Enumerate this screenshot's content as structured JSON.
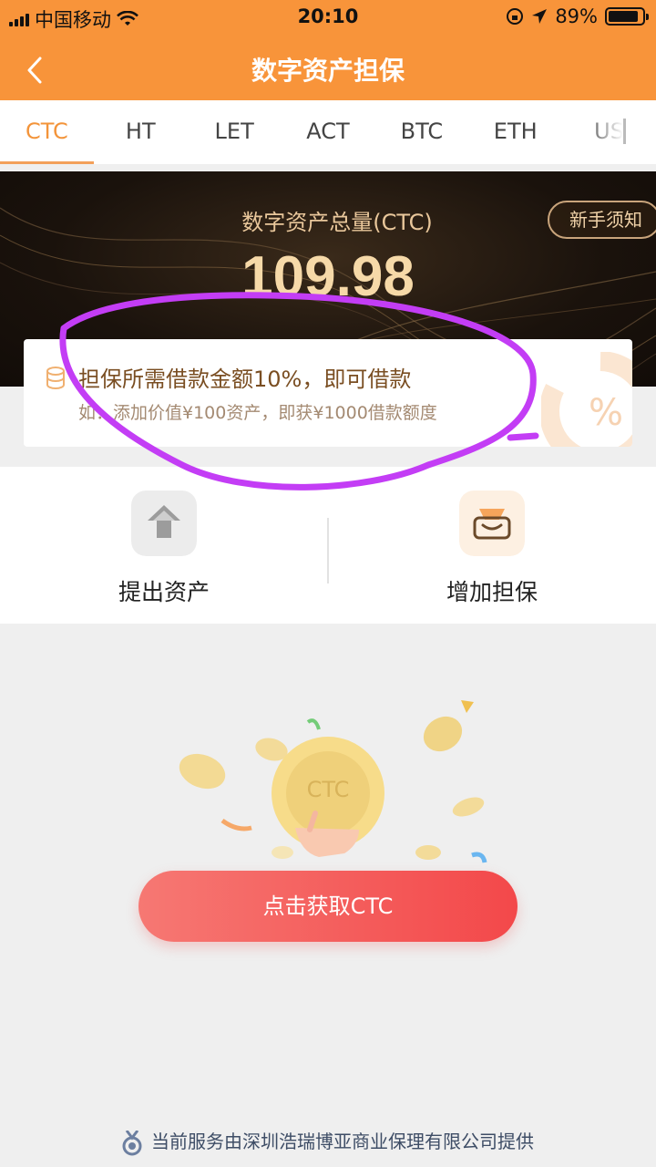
{
  "status_bar": {
    "carrier": "中国移动",
    "time": "20:10",
    "battery": "89%",
    "battery_level": 0.89
  },
  "nav": {
    "title": "数字资产担保"
  },
  "tabs": [
    {
      "label": "CTC",
      "active": true
    },
    {
      "label": "HT",
      "active": false
    },
    {
      "label": "LET",
      "active": false
    },
    {
      "label": "ACT",
      "active": false
    },
    {
      "label": "BTC",
      "active": false
    },
    {
      "label": "ETH",
      "active": false
    },
    {
      "label": "US",
      "active": false
    }
  ],
  "banner": {
    "label": "数字资产总量(CTC)",
    "value": "109.98",
    "newbie_button": "新手须知"
  },
  "info": {
    "line1": "担保所需借款金额10%，即可借款",
    "line2": "如：添加价值¥100资产，即获¥1000借款额度"
  },
  "actions": [
    {
      "label": "提出资产",
      "icon": "upload-arrow-icon"
    },
    {
      "label": "增加担保",
      "icon": "wallet-icon"
    }
  ],
  "illustration": {
    "coin_label": "CTC"
  },
  "cta": {
    "label": "点击获取CTC"
  },
  "footer": {
    "text": "当前服务由深圳浩瑞博亚商业保理有限公司提供"
  },
  "colors": {
    "accent": "#f8943a",
    "cta_start": "#f67873",
    "cta_end": "#f3484a",
    "annotation": "#c33df5"
  }
}
